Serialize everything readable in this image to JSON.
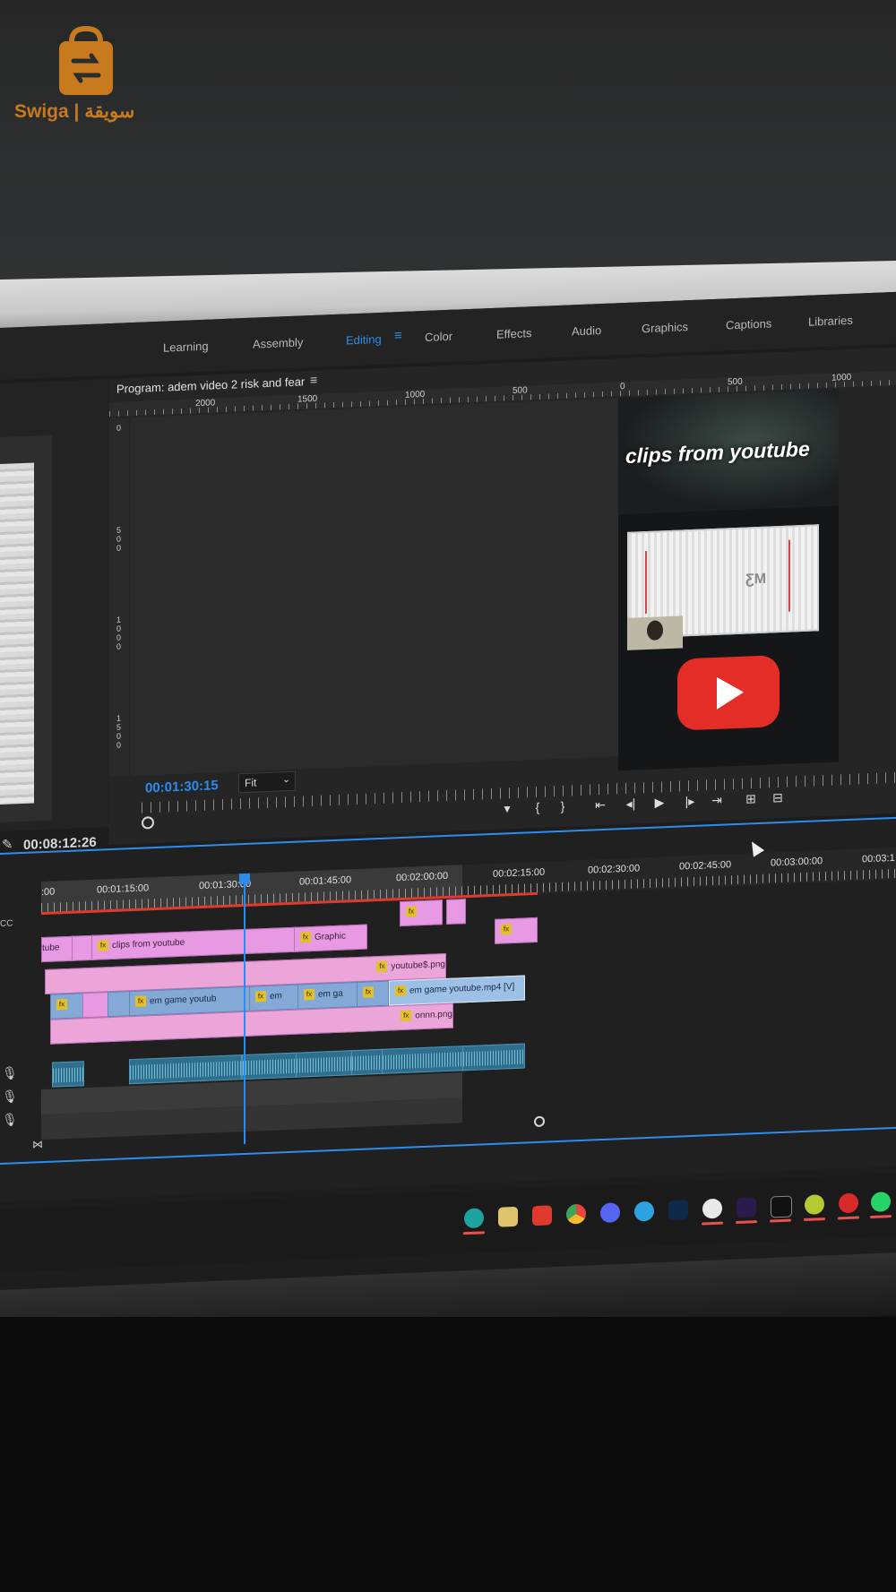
{
  "logo": {
    "text": "Swiga | سويقة"
  },
  "workspace_tabs": [
    "Learning",
    "Assembly",
    "Editing",
    "Color",
    "Effects",
    "Audio",
    "Graphics",
    "Captions",
    "Libraries"
  ],
  "active_tab": "Editing",
  "source_monitor": {
    "timecode": "00:08:12:26"
  },
  "program_monitor": {
    "title": "Program: adem video 2 risk and fear",
    "ruler_top_labels": [
      "2000",
      "1500",
      "1000",
      "500",
      "0",
      "500",
      "1000"
    ],
    "ruler_left_labels": [
      "0",
      "500",
      "1000",
      "1500"
    ],
    "frame_caption": "clips from youtube",
    "timecode": "00:01:30:15",
    "zoom": "Fit"
  },
  "timeline": {
    "ruler_labels": [
      ":00",
      "00:01:15:00",
      "00:01:30:00",
      "00:01:45:00",
      "00:02:00:00",
      "00:02:15:00",
      "00:02:30:00",
      "00:02:45:00",
      "00:03:00:00",
      "00:03:1"
    ],
    "clips": {
      "v_graphic": "Graphic",
      "v_tube": "tube",
      "v_clips": "clips from youtube",
      "v_png": "youtube$.png",
      "v_game1": "em game youtub",
      "v_em": "em",
      "v_ga": "em ga",
      "v_tooltip": "em game youtube.mp4 [V]",
      "v_onnn": "onnn.png",
      "fx": "fx"
    }
  },
  "colors": {
    "accent": "#2d8ceb",
    "clip_pink": "#e79ae3",
    "clip_blue": "#85a9d6",
    "audio": "#2f6f8d",
    "render_bar": "#e03a2e",
    "youtube_red": "#e52d27",
    "logo": "#c77a1e"
  },
  "taskbar_icons": [
    "edge-icon",
    "file-explorer-icon",
    "vivaldi-icon",
    "chrome-icon",
    "discord-icon",
    "telegram-icon",
    "photoshop-icon",
    "screen-recorder-icon",
    "premiere-pro-icon",
    "capcut-icon",
    "browser-icon",
    "recorder-icon",
    "whatsapp-icon"
  ]
}
